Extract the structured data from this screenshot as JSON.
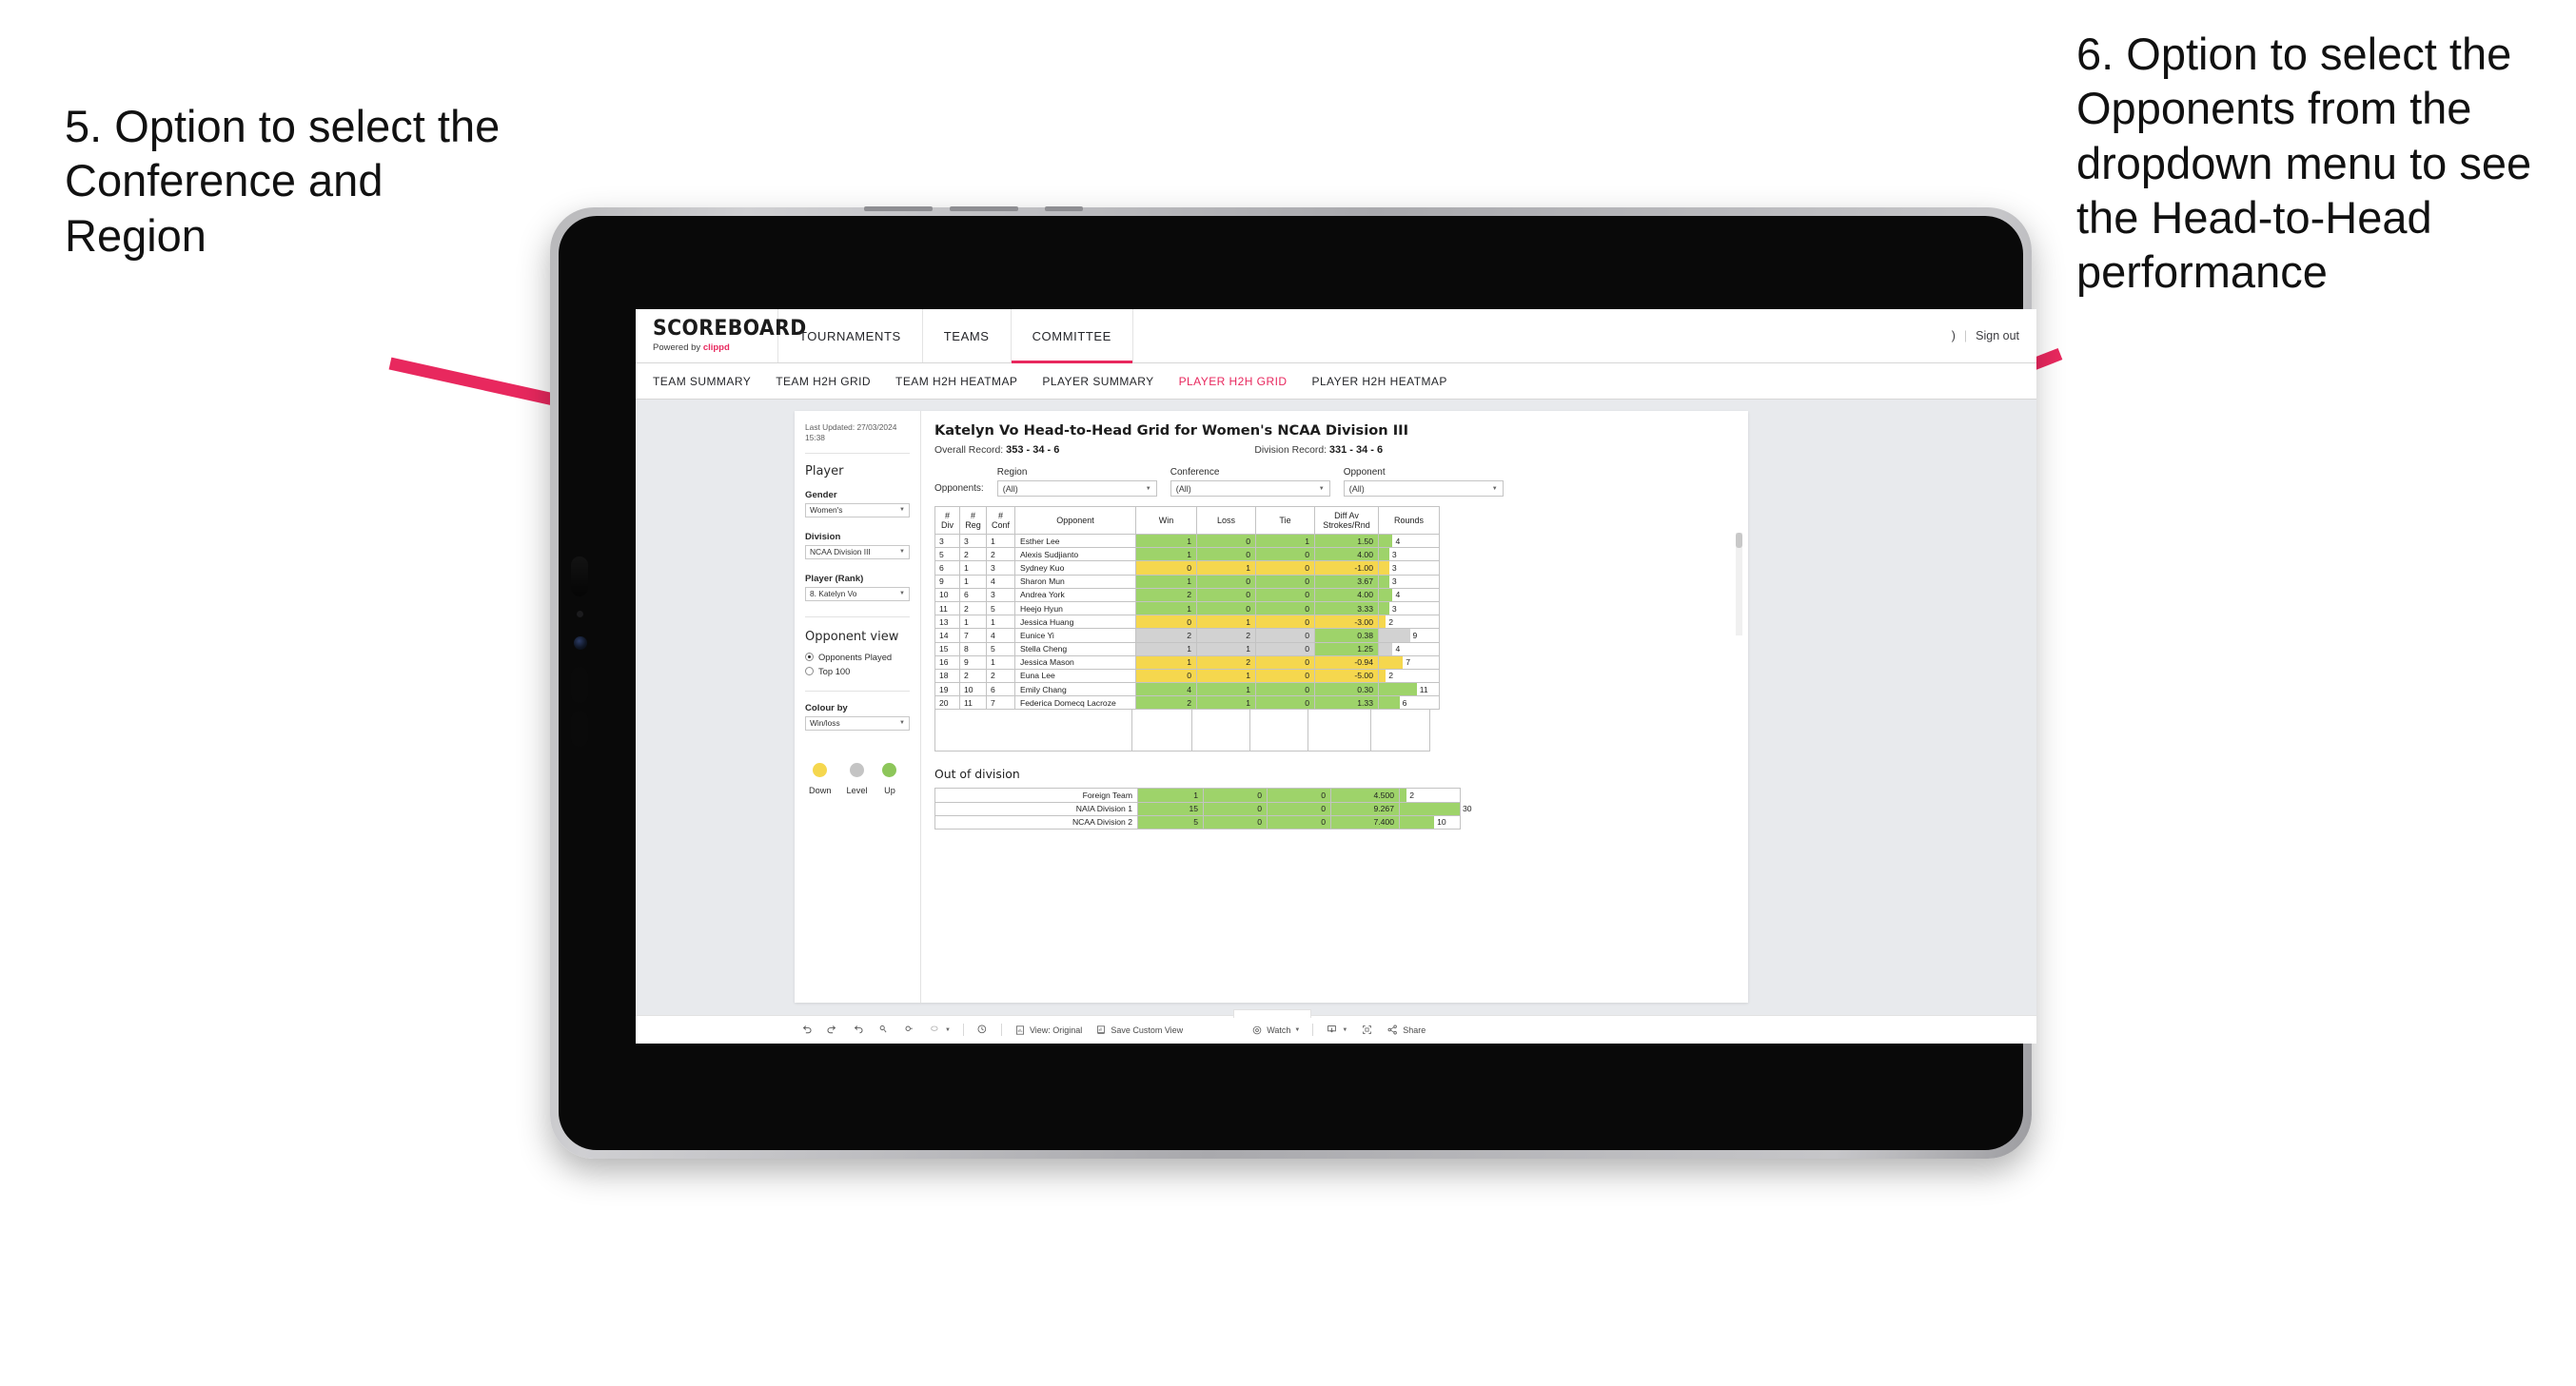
{
  "annotations": {
    "left": "5. Option to select the Conference and Region",
    "right": "6. Option to select the Opponents from the dropdown menu to see the Head-to-Head performance",
    "arrow_color": "#e8285e"
  },
  "header": {
    "logo_word": "SCOREBOARD",
    "logo_powered": "Powered by ",
    "logo_brand": "clippd",
    "nav": [
      {
        "label": "TOURNAMENTS",
        "active": false
      },
      {
        "label": "TEAMS",
        "active": false
      },
      {
        "label": "COMMITTEE",
        "active": true
      }
    ],
    "account_chevron": ")",
    "divider": "|",
    "sign_out": "Sign out"
  },
  "subnav": [
    {
      "label": "TEAM SUMMARY",
      "active": false
    },
    {
      "label": "TEAM H2H GRID",
      "active": false
    },
    {
      "label": "TEAM H2H HEATMAP",
      "active": false
    },
    {
      "label": "PLAYER SUMMARY",
      "active": false
    },
    {
      "label": "PLAYER H2H GRID",
      "active": true
    },
    {
      "label": "PLAYER H2H HEATMAP",
      "active": false
    }
  ],
  "sidebar": {
    "last_updated": "Last Updated: 27/03/2024 15:38",
    "section_player": "Player",
    "gender_label": "Gender",
    "gender_value": "Women's",
    "division_label": "Division",
    "division_value": "NCAA Division III",
    "player_label": "Player (Rank)",
    "player_value": "8. Katelyn Vo",
    "opponent_view_label": "Opponent view",
    "opponent_view_options": [
      {
        "label": "Opponents Played",
        "selected": true
      },
      {
        "label": "Top 100",
        "selected": false
      }
    ],
    "colour_by_label": "Colour by",
    "colour_by_value": "Win/loss",
    "legend": [
      {
        "label": "Down",
        "color": "#f5d74e"
      },
      {
        "label": "Level",
        "color": "#c4c4c4"
      },
      {
        "label": "Up",
        "color": "#8dc65a"
      }
    ]
  },
  "main": {
    "title": "Katelyn Vo Head-to-Head Grid for Women's NCAA Division III",
    "overall_record_label": "Overall Record: ",
    "overall_record_value": "353 - 34 - 6",
    "division_record_label": "Division Record: ",
    "division_record_value": "331 -  34 - 6",
    "opponents_label": "Opponents:",
    "filters": [
      {
        "label": "Region",
        "value": "(All)"
      },
      {
        "label": "Conference",
        "value": "(All)"
      },
      {
        "label": "Opponent",
        "value": "(All)"
      }
    ]
  },
  "chart_data": {
    "type": "table",
    "title": "Katelyn Vo Head-to-Head Grid for Women's NCAA Division III",
    "columns": [
      "# Div",
      "# Reg",
      "# Conf",
      "Opponent",
      "Win",
      "Loss",
      "Tie",
      "Diff Av Strokes/Rnd",
      "Rounds"
    ],
    "rounds_max": 30,
    "rows": [
      {
        "div": "3",
        "reg": "3",
        "conf": "1",
        "opponent": "Esther Lee",
        "win": "1",
        "loss": "0",
        "tie": "1",
        "diff": "1.50",
        "rounds": "4",
        "color": "green"
      },
      {
        "div": "5",
        "reg": "2",
        "conf": "2",
        "opponent": "Alexis Sudjianto",
        "win": "1",
        "loss": "0",
        "tie": "0",
        "diff": "4.00",
        "rounds": "3",
        "color": "green"
      },
      {
        "div": "6",
        "reg": "1",
        "conf": "3",
        "opponent": "Sydney Kuo",
        "win": "0",
        "loss": "1",
        "tie": "0",
        "diff": "-1.00",
        "rounds": "3",
        "color": "yellow"
      },
      {
        "div": "9",
        "reg": "1",
        "conf": "4",
        "opponent": "Sharon Mun",
        "win": "1",
        "loss": "0",
        "tie": "0",
        "diff": "3.67",
        "rounds": "3",
        "color": "green"
      },
      {
        "div": "10",
        "reg": "6",
        "conf": "3",
        "opponent": "Andrea York",
        "win": "2",
        "loss": "0",
        "tie": "0",
        "diff": "4.00",
        "rounds": "4",
        "color": "green"
      },
      {
        "div": "11",
        "reg": "2",
        "conf": "5",
        "opponent": "Heejo Hyun",
        "win": "1",
        "loss": "0",
        "tie": "0",
        "diff": "3.33",
        "rounds": "3",
        "color": "green"
      },
      {
        "div": "13",
        "reg": "1",
        "conf": "1",
        "opponent": "Jessica Huang",
        "win": "0",
        "loss": "1",
        "tie": "0",
        "diff": "-3.00",
        "rounds": "2",
        "color": "yellow"
      },
      {
        "div": "14",
        "reg": "7",
        "conf": "4",
        "opponent": "Eunice Yi",
        "win": "2",
        "loss": "2",
        "tie": "0",
        "diff": "0.38",
        "rounds": "9",
        "color": "grey",
        "diff_color": "green"
      },
      {
        "div": "15",
        "reg": "8",
        "conf": "5",
        "opponent": "Stella Cheng",
        "win": "1",
        "loss": "1",
        "tie": "0",
        "diff": "1.25",
        "rounds": "4",
        "color": "grey",
        "diff_color": "green"
      },
      {
        "div": "16",
        "reg": "9",
        "conf": "1",
        "opponent": "Jessica Mason",
        "win": "1",
        "loss": "2",
        "tie": "0",
        "diff": "-0.94",
        "rounds": "7",
        "color": "yellow"
      },
      {
        "div": "18",
        "reg": "2",
        "conf": "2",
        "opponent": "Euna Lee",
        "win": "0",
        "loss": "1",
        "tie": "0",
        "diff": "-5.00",
        "rounds": "2",
        "color": "yellow"
      },
      {
        "div": "19",
        "reg": "10",
        "conf": "6",
        "opponent": "Emily Chang",
        "win": "4",
        "loss": "1",
        "tie": "0",
        "diff": "0.30",
        "rounds": "11",
        "color": "green"
      },
      {
        "div": "20",
        "reg": "11",
        "conf": "7",
        "opponent": "Federica Domecq Lacroze",
        "win": "2",
        "loss": "1",
        "tie": "0",
        "diff": "1.33",
        "rounds": "6",
        "color": "green"
      }
    ],
    "out_of_division_title": "Out of division",
    "out_of_division": [
      {
        "name": "Foreign Team",
        "win": "1",
        "loss": "0",
        "tie": "0",
        "diff": "4.500",
        "rounds": "2",
        "color": "green"
      },
      {
        "name": "NAIA Division 1",
        "win": "15",
        "loss": "0",
        "tie": "0",
        "diff": "9.267",
        "rounds": "30",
        "color": "green"
      },
      {
        "name": "NCAA Division 2",
        "win": "5",
        "loss": "0",
        "tie": "0",
        "diff": "7.400",
        "rounds": "10",
        "color": "green"
      }
    ]
  },
  "toolbar": {
    "view_label": "View: Original",
    "save_label": "Save Custom View",
    "watch_label": "Watch",
    "share_label": "Share"
  }
}
